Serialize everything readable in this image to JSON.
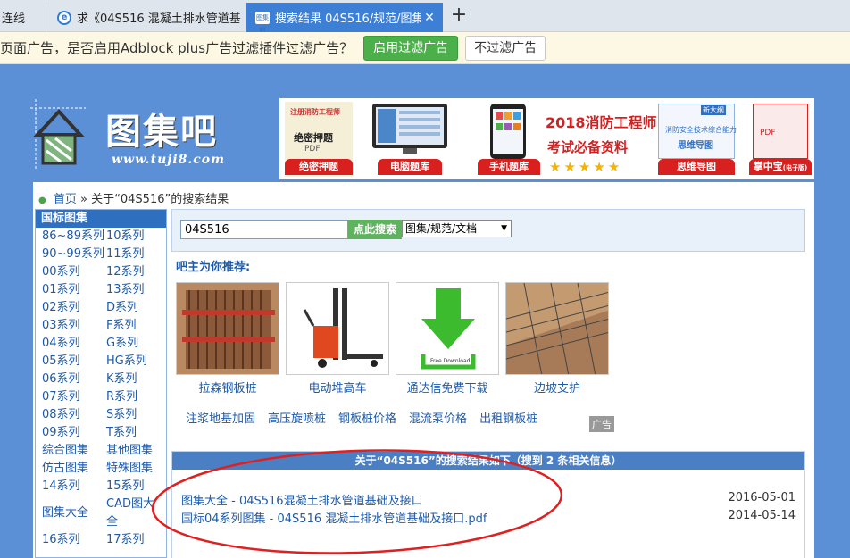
{
  "browser": {
    "tabs": [
      {
        "title": "连线"
      },
      {
        "title": "求《04S516 混凝土排水管道基"
      },
      {
        "title": "搜索结果 04S516/规范/图集【",
        "favicon_text": "图集吧"
      }
    ],
    "new_tab": "+",
    "close_icon": "✕"
  },
  "adblock_bar": {
    "message": "页面广告，是否启用Adblock plus广告过滤插件过滤广告？",
    "enable_label": "启用过滤广告",
    "disable_label": "不过滤广告"
  },
  "site": {
    "brand": "图集吧",
    "url": "www.tuji8.com"
  },
  "banner": {
    "items": [
      {
        "label": "绝密押题",
        "title": "注册消防工程师",
        "sub": "绝密押题",
        "tag": "PDF"
      },
      {
        "label": "电脑题库"
      },
      {
        "label": "手机题库"
      },
      {
        "headline": "2018消防工程师",
        "subline": "考试必备资料",
        "stars": 5
      },
      {
        "label": "思维导图",
        "sub": "消防安全技术综合能力",
        "sub2": "思维导图",
        "badge": "新大纲"
      },
      {
        "label": "掌中宝",
        "label_small": "(电子版)",
        "tag": "PDF"
      }
    ]
  },
  "breadcrumb": {
    "home": "首页",
    "sep": "»",
    "current": "关于“04S516”的搜索结果"
  },
  "sidebar": {
    "title": "国标图集",
    "items": [
      "86~89系列",
      "10系列",
      "90~99系列",
      "11系列",
      "00系列",
      "12系列",
      "01系列",
      "13系列",
      "02系列",
      "D系列",
      "03系列",
      "F系列",
      "04系列",
      "G系列",
      "05系列",
      "HG系列",
      "06系列",
      "K系列",
      "07系列",
      "R系列",
      "08系列",
      "S系列",
      "09系列",
      "T系列",
      "综合图集",
      "其他图集",
      "仿古图集",
      "特殊图集",
      "14系列",
      "15系列",
      "图集大全",
      "CAD图大全",
      "16系列",
      "17系列"
    ]
  },
  "search": {
    "query": "04S516",
    "button": "点此搜索",
    "category": "图集/规范/文档",
    "dropdown_icon": "▼"
  },
  "recommend": {
    "title": "吧主为你推荐:",
    "items": [
      {
        "caption": "拉森钢板桩"
      },
      {
        "caption": "电动堆高车"
      },
      {
        "caption": "通达信免费下载",
        "img_text": "Free Download"
      },
      {
        "caption": "边坡支护"
      }
    ],
    "links": [
      "注浆地基加固",
      "高压旋喷桩",
      "钢板桩价格",
      "混流泵价格",
      "出租钢板桩"
    ],
    "ad_tag": "广告"
  },
  "results": {
    "header": "关于“04S516”的搜索结果如下（搜到 2 条相关信息）",
    "rows": [
      {
        "title": "图集大全 - 04S516混凝土排水管道基础及接口",
        "date": "2016-05-01"
      },
      {
        "title": "国标04系列图集 - 04S516 混凝土排水管道基础及接口.pdf",
        "date": "2014-05-14"
      }
    ]
  },
  "colors": {
    "page_bg": "#5b8fd6",
    "link": "#1d5aa8",
    "active_tab": "#3c7fd4",
    "annotation": "#e02020"
  }
}
